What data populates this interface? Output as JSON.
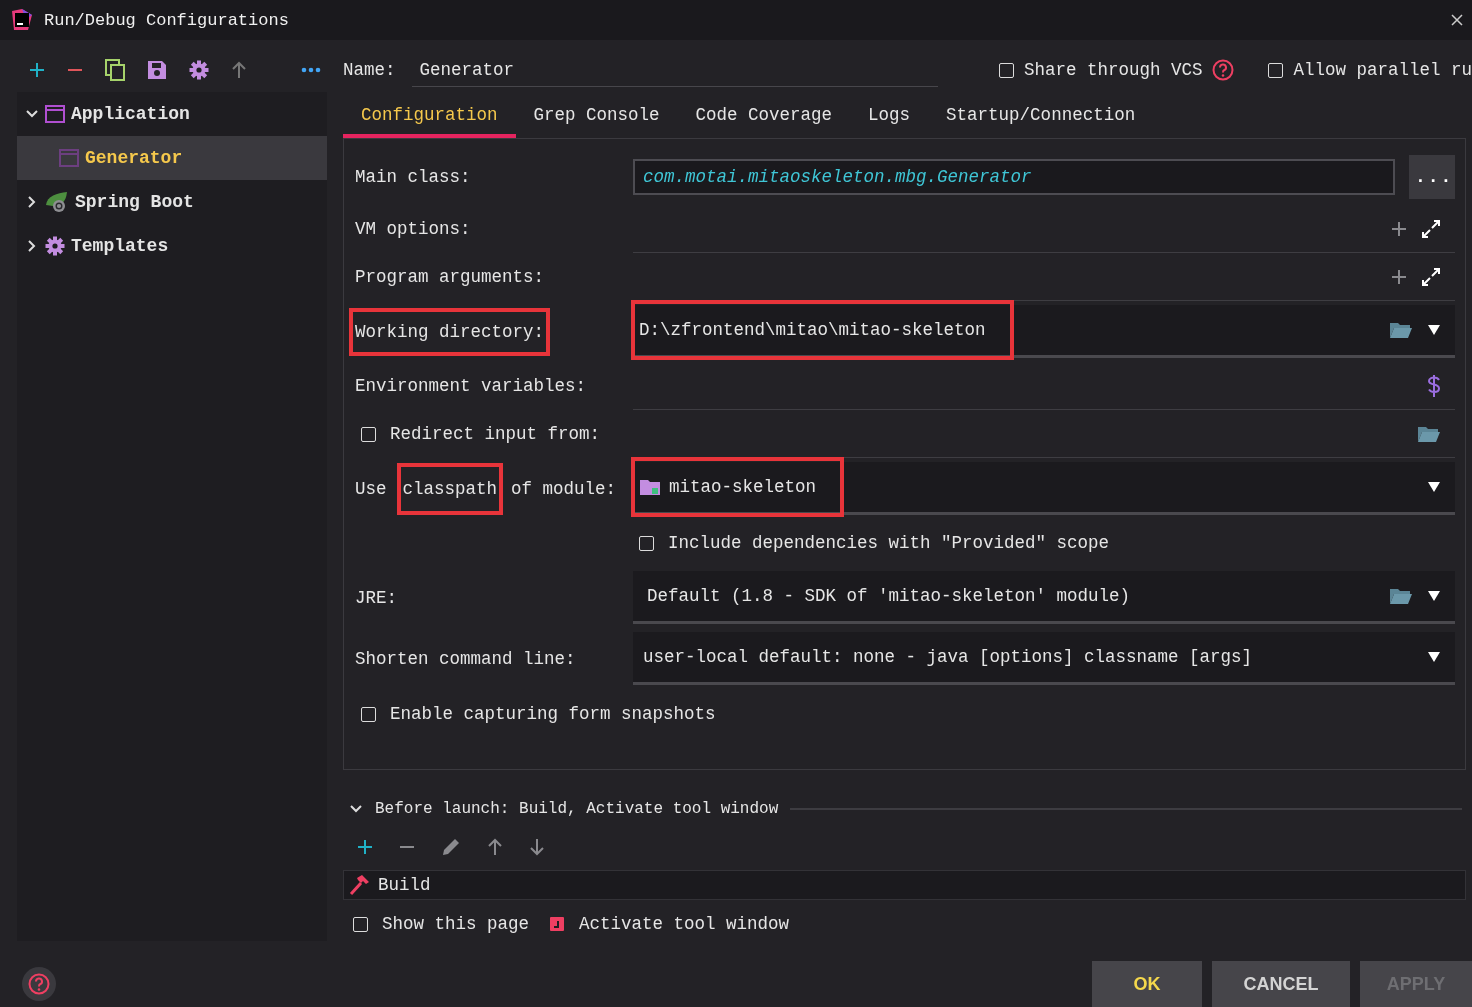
{
  "window": {
    "title": "Run/Debug Configurations"
  },
  "tree": [
    {
      "label": "Application",
      "kind": "application",
      "expanded": true,
      "selected": false,
      "children": [
        {
          "label": "Generator",
          "kind": "application",
          "selected": true
        }
      ]
    },
    {
      "label": "Spring Boot",
      "kind": "spring",
      "expanded": false,
      "selected": false
    },
    {
      "label": "Templates",
      "kind": "gear",
      "expanded": false,
      "selected": false
    }
  ],
  "name_field": {
    "label": "Name:",
    "value": "Generator"
  },
  "header_options": [
    {
      "label": "Share through VCS",
      "checked": false,
      "help": true
    },
    {
      "label": "Allow parallel ru",
      "checked": false,
      "help": false
    }
  ],
  "tabs": [
    {
      "label": "Configuration",
      "selected": true
    },
    {
      "label": "Grep Console",
      "selected": false
    },
    {
      "label": "Code Coverage",
      "selected": false
    },
    {
      "label": "Logs",
      "selected": false
    },
    {
      "label": "Startup/Connection",
      "selected": false
    }
  ],
  "rows": [
    {
      "kind": "text",
      "label": "Main class:",
      "value": "com.motai.mitaoskeleton.mbg.Generator",
      "button": "..."
    },
    {
      "kind": "expandable",
      "label": "VM options:"
    },
    {
      "kind": "expandable",
      "label": "Program arguments:"
    },
    {
      "kind": "path",
      "label": "Working directory:",
      "value": "D:\\zfrontend\\mitao\\mitao-skeleton",
      "label_highlighted": true,
      "value_highlighted": true
    },
    {
      "kind": "env",
      "label": "Environment variables:"
    },
    {
      "kind": "checkbox-path",
      "label": "Redirect input from:",
      "checked": false
    },
    {
      "kind": "module",
      "label_parts": [
        {
          "text": "Use",
          "highlighted": false
        },
        {
          "text": "classpath",
          "highlighted": true
        },
        {
          "text": "of module:",
          "highlighted": false
        }
      ],
      "value": "mitao-skeleton",
      "value_highlighted": true
    },
    {
      "kind": "option",
      "label": "Include dependencies with \"Provided\" scope",
      "checked": false
    },
    {
      "kind": "path",
      "label": "JRE:",
      "value": "Default (1.8 - SDK of 'mitao-skeleton' module)",
      "label_highlighted": false,
      "value_highlighted": false
    },
    {
      "kind": "dropdown",
      "label": "Shorten command line:",
      "value": "user-local default: none - java [options] classname [args]"
    },
    {
      "kind": "checkbox",
      "label": "Enable capturing form snapshots",
      "checked": false
    }
  ],
  "before_launch": {
    "title": "Before launch: Build, Activate tool window",
    "expanded": true,
    "tasks": [
      {
        "label": "Build"
      }
    ],
    "options": [
      {
        "label": "Show this page",
        "kind": "checkbox",
        "checked": false
      },
      {
        "label": "Activate tool window",
        "kind": "toggle",
        "checked": true
      }
    ]
  },
  "buttons": [
    {
      "label": "OK",
      "kind": "default",
      "disabled": false
    },
    {
      "label": "CANCEL",
      "kind": "normal",
      "disabled": false
    },
    {
      "label": "APPLY",
      "kind": "normal",
      "disabled": true
    }
  ]
}
